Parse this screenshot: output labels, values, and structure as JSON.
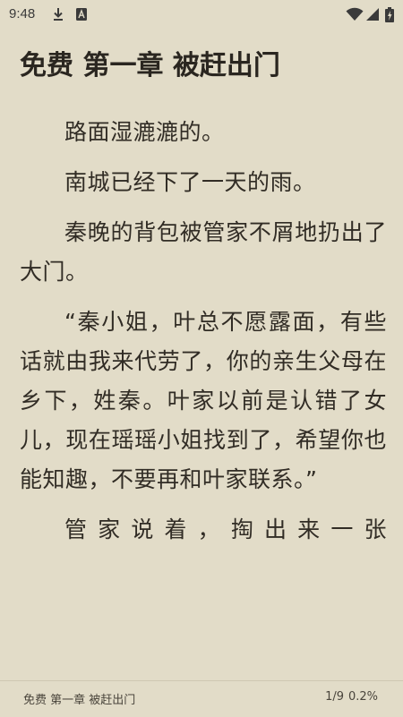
{
  "status_bar": {
    "time": "9:48",
    "icons": [
      "download-icon",
      "a-badge-icon",
      "wifi-icon",
      "signal-icon",
      "battery-icon"
    ]
  },
  "chapter": {
    "title": "免费 第一章 被赶出门"
  },
  "content": {
    "paragraphs": [
      "路面湿漉漉的。",
      "南城已经下了一天的雨。",
      "秦晚的背包被管家不屑地扔出了大门。",
      "“秦小姐，叶总不愿露面，有些话就由我来代劳了，你的亲生父母在乡下，姓秦。叶家以前是认错了女儿，现在瑶瑶小姐找到了，希望你也能知趣，不要再和叶家联系。”",
      "管家说着，掏出来一张"
    ]
  },
  "footer": {
    "chapter_title": "免费 第一章 被赶出门",
    "page": "1/9",
    "progress": "0.2%"
  }
}
